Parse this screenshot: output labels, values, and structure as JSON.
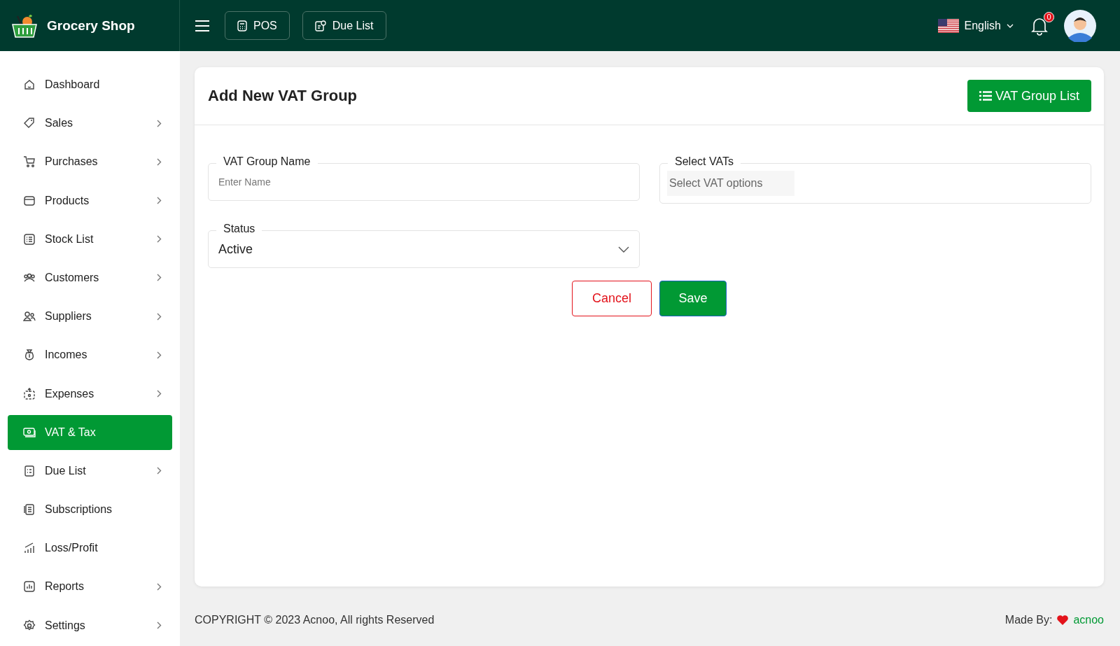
{
  "header": {
    "brand": "Grocery Shop",
    "buttons": [
      {
        "label": "POS"
      },
      {
        "label": "Due List"
      }
    ],
    "language": "English",
    "notification_count": "0"
  },
  "sidebar": {
    "items": [
      {
        "label": "Dashboard",
        "selected": false,
        "has_submenu": false
      },
      {
        "label": "Sales",
        "selected": false,
        "has_submenu": true
      },
      {
        "label": "Purchases",
        "selected": false,
        "has_submenu": true
      },
      {
        "label": "Products",
        "selected": false,
        "has_submenu": true
      },
      {
        "label": "Stock List",
        "selected": false,
        "has_submenu": true
      },
      {
        "label": "Customers",
        "selected": false,
        "has_submenu": true
      },
      {
        "label": "Suppliers",
        "selected": false,
        "has_submenu": true
      },
      {
        "label": "Incomes",
        "selected": false,
        "has_submenu": true
      },
      {
        "label": "Expenses",
        "selected": false,
        "has_submenu": true
      },
      {
        "label": "VAT & Tax",
        "selected": true,
        "has_submenu": false
      },
      {
        "label": "Due List",
        "selected": false,
        "has_submenu": true
      },
      {
        "label": "Subscriptions",
        "selected": false,
        "has_submenu": false
      },
      {
        "label": "Loss/Profit",
        "selected": false,
        "has_submenu": false
      },
      {
        "label": "Reports",
        "selected": false,
        "has_submenu": true
      },
      {
        "label": "Settings",
        "selected": false,
        "has_submenu": true
      }
    ]
  },
  "card": {
    "title": "Add New VAT Group",
    "list_button": "VAT Group List",
    "fields": [
      {
        "kind": "text",
        "label": "VAT Group Name",
        "placeholder": "Enter Name"
      },
      {
        "kind": "multiselect",
        "label": "Select VATs",
        "placeholder": "Select VAT options"
      },
      {
        "kind": "select",
        "label": "Status",
        "value": "Active"
      }
    ],
    "cancel": "Cancel",
    "save": "Save"
  },
  "footer": {
    "copyright": "COPYRIGHT © 2023 Acnoo, All rights Reserved",
    "made_by": "Made By:",
    "author": "acnoo"
  }
}
